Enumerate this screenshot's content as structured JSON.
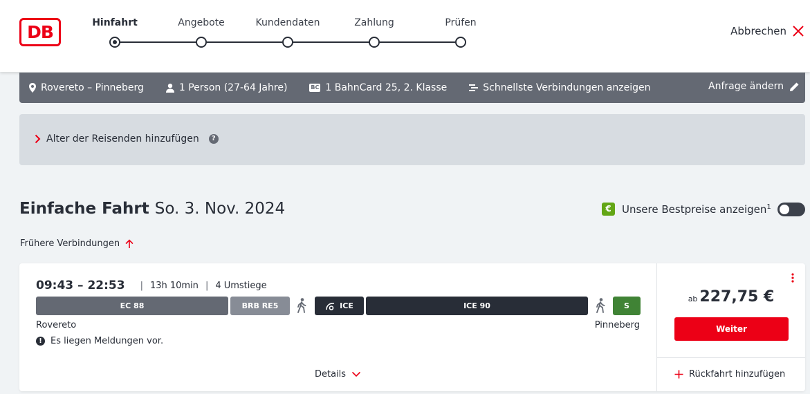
{
  "header": {
    "logo_text": "DB",
    "steps": [
      {
        "label": "Hinfahrt",
        "active": true
      },
      {
        "label": "Angebote",
        "active": false
      },
      {
        "label": "Kundendaten",
        "active": false
      },
      {
        "label": "Zahlung",
        "active": false
      },
      {
        "label": "Prüfen",
        "active": false
      }
    ],
    "cancel_label": "Abbrechen",
    "cancel_icon": "close-icon"
  },
  "query": {
    "route": "Rovereto – Pinneberg",
    "passengers": "1 Person (27-64 Jahre)",
    "bahncard_badge": "BC",
    "bahncard": "1 BahnCard 25, 2. Klasse",
    "fastest": "Schnellste Verbindungen anzeigen",
    "change_label": "Anfrage ändern"
  },
  "age_panel": {
    "link_label": "Alter der Reisenden hinzufügen",
    "help_glyph": "?"
  },
  "results": {
    "title": "Einfache Fahrt",
    "date": "So. 3. Nov. 2024",
    "best_badge": "€",
    "best_label": "Unsere Bestpreise anzeigen",
    "best_sup": "1",
    "earlier_label": "Frühere Verbindungen"
  },
  "connection": {
    "times": "09:43 – 22:53",
    "duration": "13h 10min",
    "transfers": "4 Umstiege",
    "segments": [
      {
        "label": "EC 88",
        "color": "#646973"
      },
      {
        "label": "BRB RE5",
        "color": "#878c96"
      },
      {
        "label": "ICE",
        "color": "#282d37"
      },
      {
        "label": "ICE 90",
        "color": "#282d37"
      },
      {
        "label": "S",
        "color": "#408335"
      }
    ],
    "origin": "Rovereto",
    "destination": "Pinneberg",
    "notice": "Es liegen Meldungen vor.",
    "notice_glyph": "!",
    "details_label": "Details",
    "price_prefix": "ab",
    "price": "227,75 €",
    "continue_label": "Weiter",
    "return_label": "Rückfahrt hinzufügen"
  },
  "colors": {
    "accent": "#ec0016",
    "query_bar": "#646973",
    "background": "#f0f3f5"
  }
}
